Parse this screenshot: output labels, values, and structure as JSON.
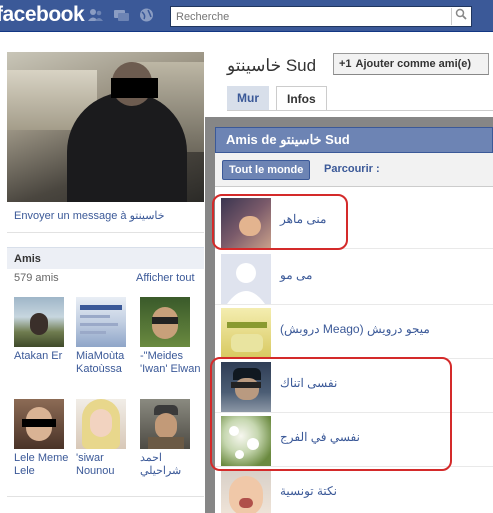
{
  "topbar": {
    "logo": "facebook",
    "search_placeholder": "Recherche",
    "icons": [
      "friend-requests-icon",
      "messages-icon",
      "notifications-globe-icon",
      "search-magnifier-icon"
    ]
  },
  "left": {
    "send_message": "Envoyer un message à خاسينتو",
    "friends_title": "Amis",
    "friends_count": "579 amis",
    "see_all": "Afficher tout",
    "friends": [
      {
        "name": "Atakan Er"
      },
      {
        "name": "MiaMoùta Katoùssa"
      },
      {
        "name": "-\"Meides 'Iwan' Elwan"
      },
      {
        "name": "Lele Meme Lele"
      },
      {
        "name": "'siwar Nounou"
      },
      {
        "name": "احمد شراحيلي"
      }
    ]
  },
  "header": {
    "profile_name": "خاسينتو Sud",
    "add_friend_label": "Ajouter comme ami(e)",
    "add_friend_icon": "+1",
    "tabs": [
      {
        "label": "Mur"
      },
      {
        "label": "Infos"
      }
    ]
  },
  "dialog": {
    "title": "Amis de خاسينتو Sud",
    "filter_all": "Tout le monde",
    "browse": "Parcourir :",
    "rows": [
      {
        "name": "منى ماهر"
      },
      {
        "name": "مى مو"
      },
      {
        "name": "(دروبش Meago) ميجو درويش"
      },
      {
        "name": "نفسى اتناك"
      },
      {
        "name": "نفسي في الفرج"
      },
      {
        "name": "نكتة تونسية"
      }
    ]
  },
  "colors": {
    "brand": "#3b5998",
    "dialog_header": "#6d84b4",
    "highlight_circle": "#d42a2a"
  }
}
